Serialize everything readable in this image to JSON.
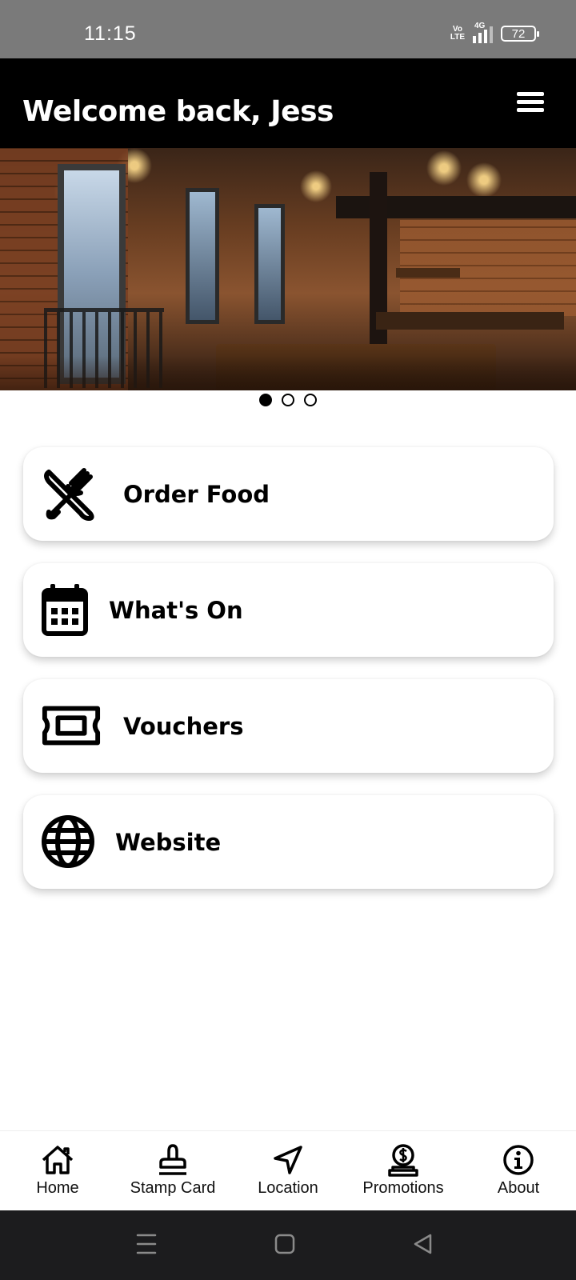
{
  "status_bar": {
    "time": "11:15",
    "volte_top": "Vo",
    "volte_bottom": "LTE",
    "network": "4G",
    "battery": "72"
  },
  "header": {
    "title": "Welcome back, Jess",
    "menu_icon": "hamburger-menu-icon"
  },
  "carousel": {
    "image": "restaurant-interior-photo",
    "slides": 3,
    "active_index": 0
  },
  "menu": [
    {
      "label": "Order Food",
      "icon": "utensils-icon"
    },
    {
      "label": "What's On",
      "icon": "calendar-icon"
    },
    {
      "label": "Vouchers",
      "icon": "ticket-icon"
    },
    {
      "label": "Website",
      "icon": "globe-icon"
    }
  ],
  "bottom_nav": [
    {
      "label": "Home",
      "icon": "home-icon"
    },
    {
      "label": "Stamp Card",
      "icon": "stamp-icon"
    },
    {
      "label": "Location",
      "icon": "location-arrow-icon"
    },
    {
      "label": "Promotions",
      "icon": "coin-hand-icon"
    },
    {
      "label": "About",
      "icon": "info-icon"
    }
  ],
  "colors": {
    "status_bar": "#7a7a7a",
    "header": "#000000",
    "card": "#ffffff",
    "system_nav": "#1c1c1e"
  }
}
